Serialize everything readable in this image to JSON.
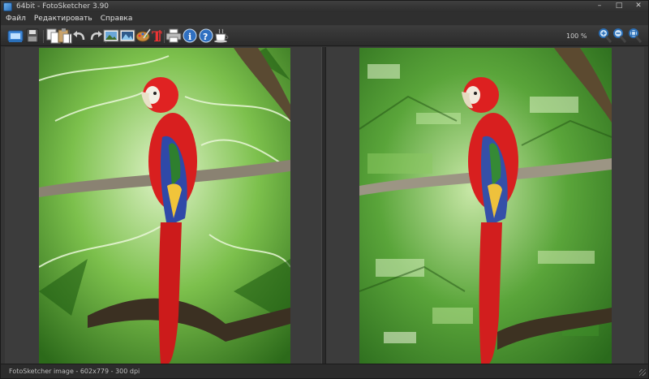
{
  "window": {
    "title": "64bit - FotoSketcher 3.90",
    "controls": {
      "minimize": "–",
      "maximize": "□",
      "close": "✕"
    }
  },
  "menu": {
    "items": [
      {
        "label": "Файл"
      },
      {
        "label": "Редактировать"
      },
      {
        "label": "Справка"
      }
    ]
  },
  "toolbar": {
    "buttons": [
      {
        "icon": "open-image-icon"
      },
      {
        "icon": "save-icon"
      },
      {
        "icon": "copy-icon"
      },
      {
        "icon": "paste-icon"
      },
      {
        "icon": "undo-icon"
      },
      {
        "icon": "redo-icon"
      },
      {
        "icon": "original-image-icon"
      },
      {
        "icon": "result-image-icon"
      },
      {
        "icon": "paint-palette-icon"
      },
      {
        "icon": "add-text-icon"
      },
      {
        "icon": "print-icon"
      },
      {
        "icon": "info-icon"
      },
      {
        "icon": "help-icon"
      },
      {
        "icon": "coffee-donate-icon"
      }
    ],
    "zoom_label": "100 %",
    "zoom_buttons": [
      {
        "icon": "zoom-in-icon"
      },
      {
        "icon": "zoom-out-icon"
      },
      {
        "icon": "zoom-fit-icon"
      }
    ]
  },
  "status": {
    "text": "FotoSketcher image - 602x779 - 300 dpi"
  },
  "colors": {
    "accent_blue": "#2a6fb8",
    "parrot_red": "#d81f1f",
    "foliage_green": "#3f9a2c"
  }
}
